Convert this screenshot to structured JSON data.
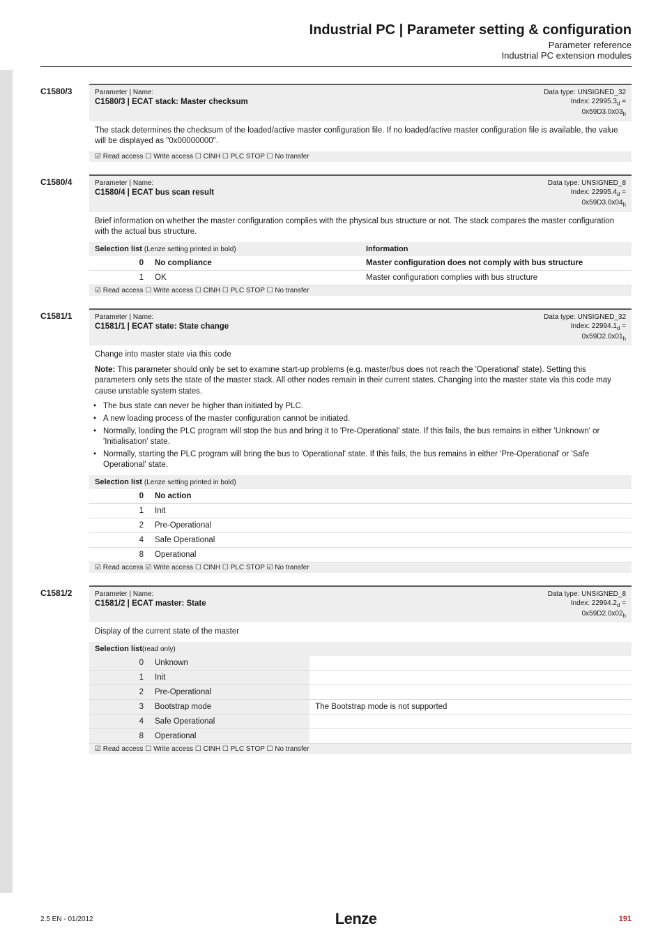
{
  "header": {
    "title": "Industrial PC | Parameter setting & configuration",
    "sub1": "Parameter reference",
    "sub2": "Industrial PC extension modules"
  },
  "sections": [
    {
      "code": "C1580/3",
      "paramLabel": "Parameter | Name:",
      "name": "C1580/3 | ECAT stack: Master checksum",
      "right1": "Data type: UNSIGNED_32",
      "right2": "Index: 22995.3",
      "right3": "0x59D3.0x03",
      "descr": "The stack determines the checksum of the loaded/active master configuration file. If no loaded/active master configuration file is available, the value will be displayed as \"0x00000000\".",
      "access": "☑ Read access   ☐ Write access   ☐ CINH   ☐ PLC STOP   ☐ No transfer"
    },
    {
      "code": "C1580/4",
      "paramLabel": "Parameter | Name:",
      "name": "C1580/4 | ECAT bus scan result",
      "right1": "Data type: UNSIGNED_8",
      "right2": "Index: 22995.4",
      "right3": "0x59D3.0x04",
      "descr": "Brief information on whether the master configuration complies with the physical bus structure or not. The stack compares the master configuration with the actual bus structure.",
      "selHead1": "Selection list",
      "selHead1Light": "(Lenze setting printed in bold)",
      "selHead2": "Information",
      "rows": [
        {
          "v": "0",
          "txt": "No compliance",
          "info": "Master configuration does not comply with bus structure",
          "bold": true
        },
        {
          "v": "1",
          "txt": "OK",
          "info": "Master configuration complies with bus structure"
        }
      ],
      "access": "☑ Read access   ☐ Write access   ☐ CINH   ☐ PLC STOP   ☐ No transfer"
    },
    {
      "code": "C1581/1",
      "paramLabel": "Parameter | Name:",
      "name": "C1581/1 | ECAT state: State change",
      "right1": "Data type: UNSIGNED_32",
      "right2": "Index: 22994.1",
      "right3": "0x59D2.0x01",
      "descr": "Change into master state via this code",
      "noteLabel": "Note:",
      "noteText": " This parameter should only be set to examine start-up problems (e.g. master/bus does not reach the 'Operational' state). Setting this parameters only sets the state of the master stack. All other nodes remain in their current states. Changing into the master state via this code may cause unstable system states.",
      "bullets": [
        "The bus state can never be higher than initiated by PLC.",
        "A new loading process of the master configuration cannot be initiated.",
        "Normally, loading the PLC program will stop the bus and bring it to 'Pre-Operational' state. If this fails, the bus remains in either 'Unknown' or 'Initialisation' state.",
        "Normally, starting the PLC program will bring the bus to 'Operational' state. If this fails, the bus remains in either 'Pre-Operational' or 'Safe Operational' state."
      ],
      "selHead1": "Selection list",
      "selHead1Light": "(Lenze setting printed in bold)",
      "rows": [
        {
          "v": "0",
          "txt": "No action",
          "bold": true
        },
        {
          "v": "1",
          "txt": "Init"
        },
        {
          "v": "2",
          "txt": "Pre-Operational"
        },
        {
          "v": "4",
          "txt": "Safe Operational"
        },
        {
          "v": "8",
          "txt": "Operational"
        }
      ],
      "access": "☑ Read access   ☑ Write access   ☐ CINH   ☐ PLC STOP   ☑ No transfer"
    },
    {
      "code": "C1581/2",
      "paramLabel": "Parameter | Name:",
      "name": "C1581/2 | ECAT master: State",
      "right1": "Data type: UNSIGNED_8",
      "right2": "Index: 22994.2",
      "right3": "0x59D2.0x02",
      "descr": "Display of the current state of the master",
      "selHead1": "Selection list",
      "selHead1Light": "(read only)",
      "rows": [
        {
          "v": "0",
          "txt": "Unknown",
          "bg": true
        },
        {
          "v": "1",
          "txt": "Init",
          "bg": true
        },
        {
          "v": "2",
          "txt": "Pre-Operational",
          "bg": true
        },
        {
          "v": "3",
          "txt": "Bootstrap mode",
          "info": "The Bootstrap mode is not supported",
          "bg": true
        },
        {
          "v": "4",
          "txt": "Safe Operational",
          "bg": true
        },
        {
          "v": "8",
          "txt": "Operational",
          "bg": true
        }
      ],
      "access": "☑ Read access   ☐ Write access   ☐ CINH   ☐ PLC STOP   ☐ No transfer"
    }
  ],
  "footer": {
    "left": "2.5 EN - 01/2012",
    "logo": "Lenze",
    "page": "191"
  },
  "subD": "d",
  "subH": "h",
  "eq": " ="
}
